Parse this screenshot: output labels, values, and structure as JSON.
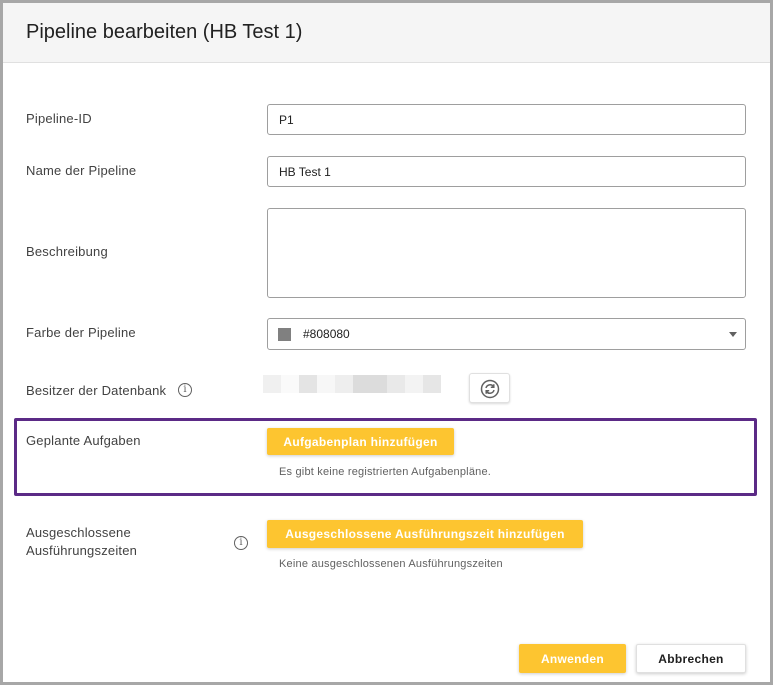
{
  "dialog": {
    "title": "Pipeline bearbeiten (HB Test 1)"
  },
  "form": {
    "pipeline_id": {
      "label": "Pipeline-ID",
      "value": "P1"
    },
    "name": {
      "label": "Name der Pipeline",
      "value": "HB Test 1"
    },
    "description": {
      "label": "Beschreibung",
      "value": ""
    },
    "color": {
      "label": "Farbe der Pipeline",
      "value": "#808080",
      "swatch": "#808080"
    },
    "owner": {
      "label": "Besitzer der Datenbank",
      "info_icon": "info-icon",
      "refresh_icon": "refresh-icon"
    },
    "scheduled_tasks": {
      "label": "Geplante Aufgaben",
      "button": "Aufgabenplan hinzufügen",
      "empty_text": "Es gibt keine registrierten Aufgabenpläne."
    },
    "excluded_times": {
      "label_line1": "Ausgeschlossene",
      "label_line2": "Ausführungszeiten",
      "info_icon": "info-icon",
      "button": "Ausgeschlossene Ausführungszeit hinzufügen",
      "empty_text": "Keine ausgeschlossenen Ausführungszeiten"
    }
  },
  "footer": {
    "apply": "Anwenden",
    "cancel": "Abbrechen"
  },
  "colors": {
    "accent": "#fdc530",
    "highlight": "#5b2a86"
  }
}
